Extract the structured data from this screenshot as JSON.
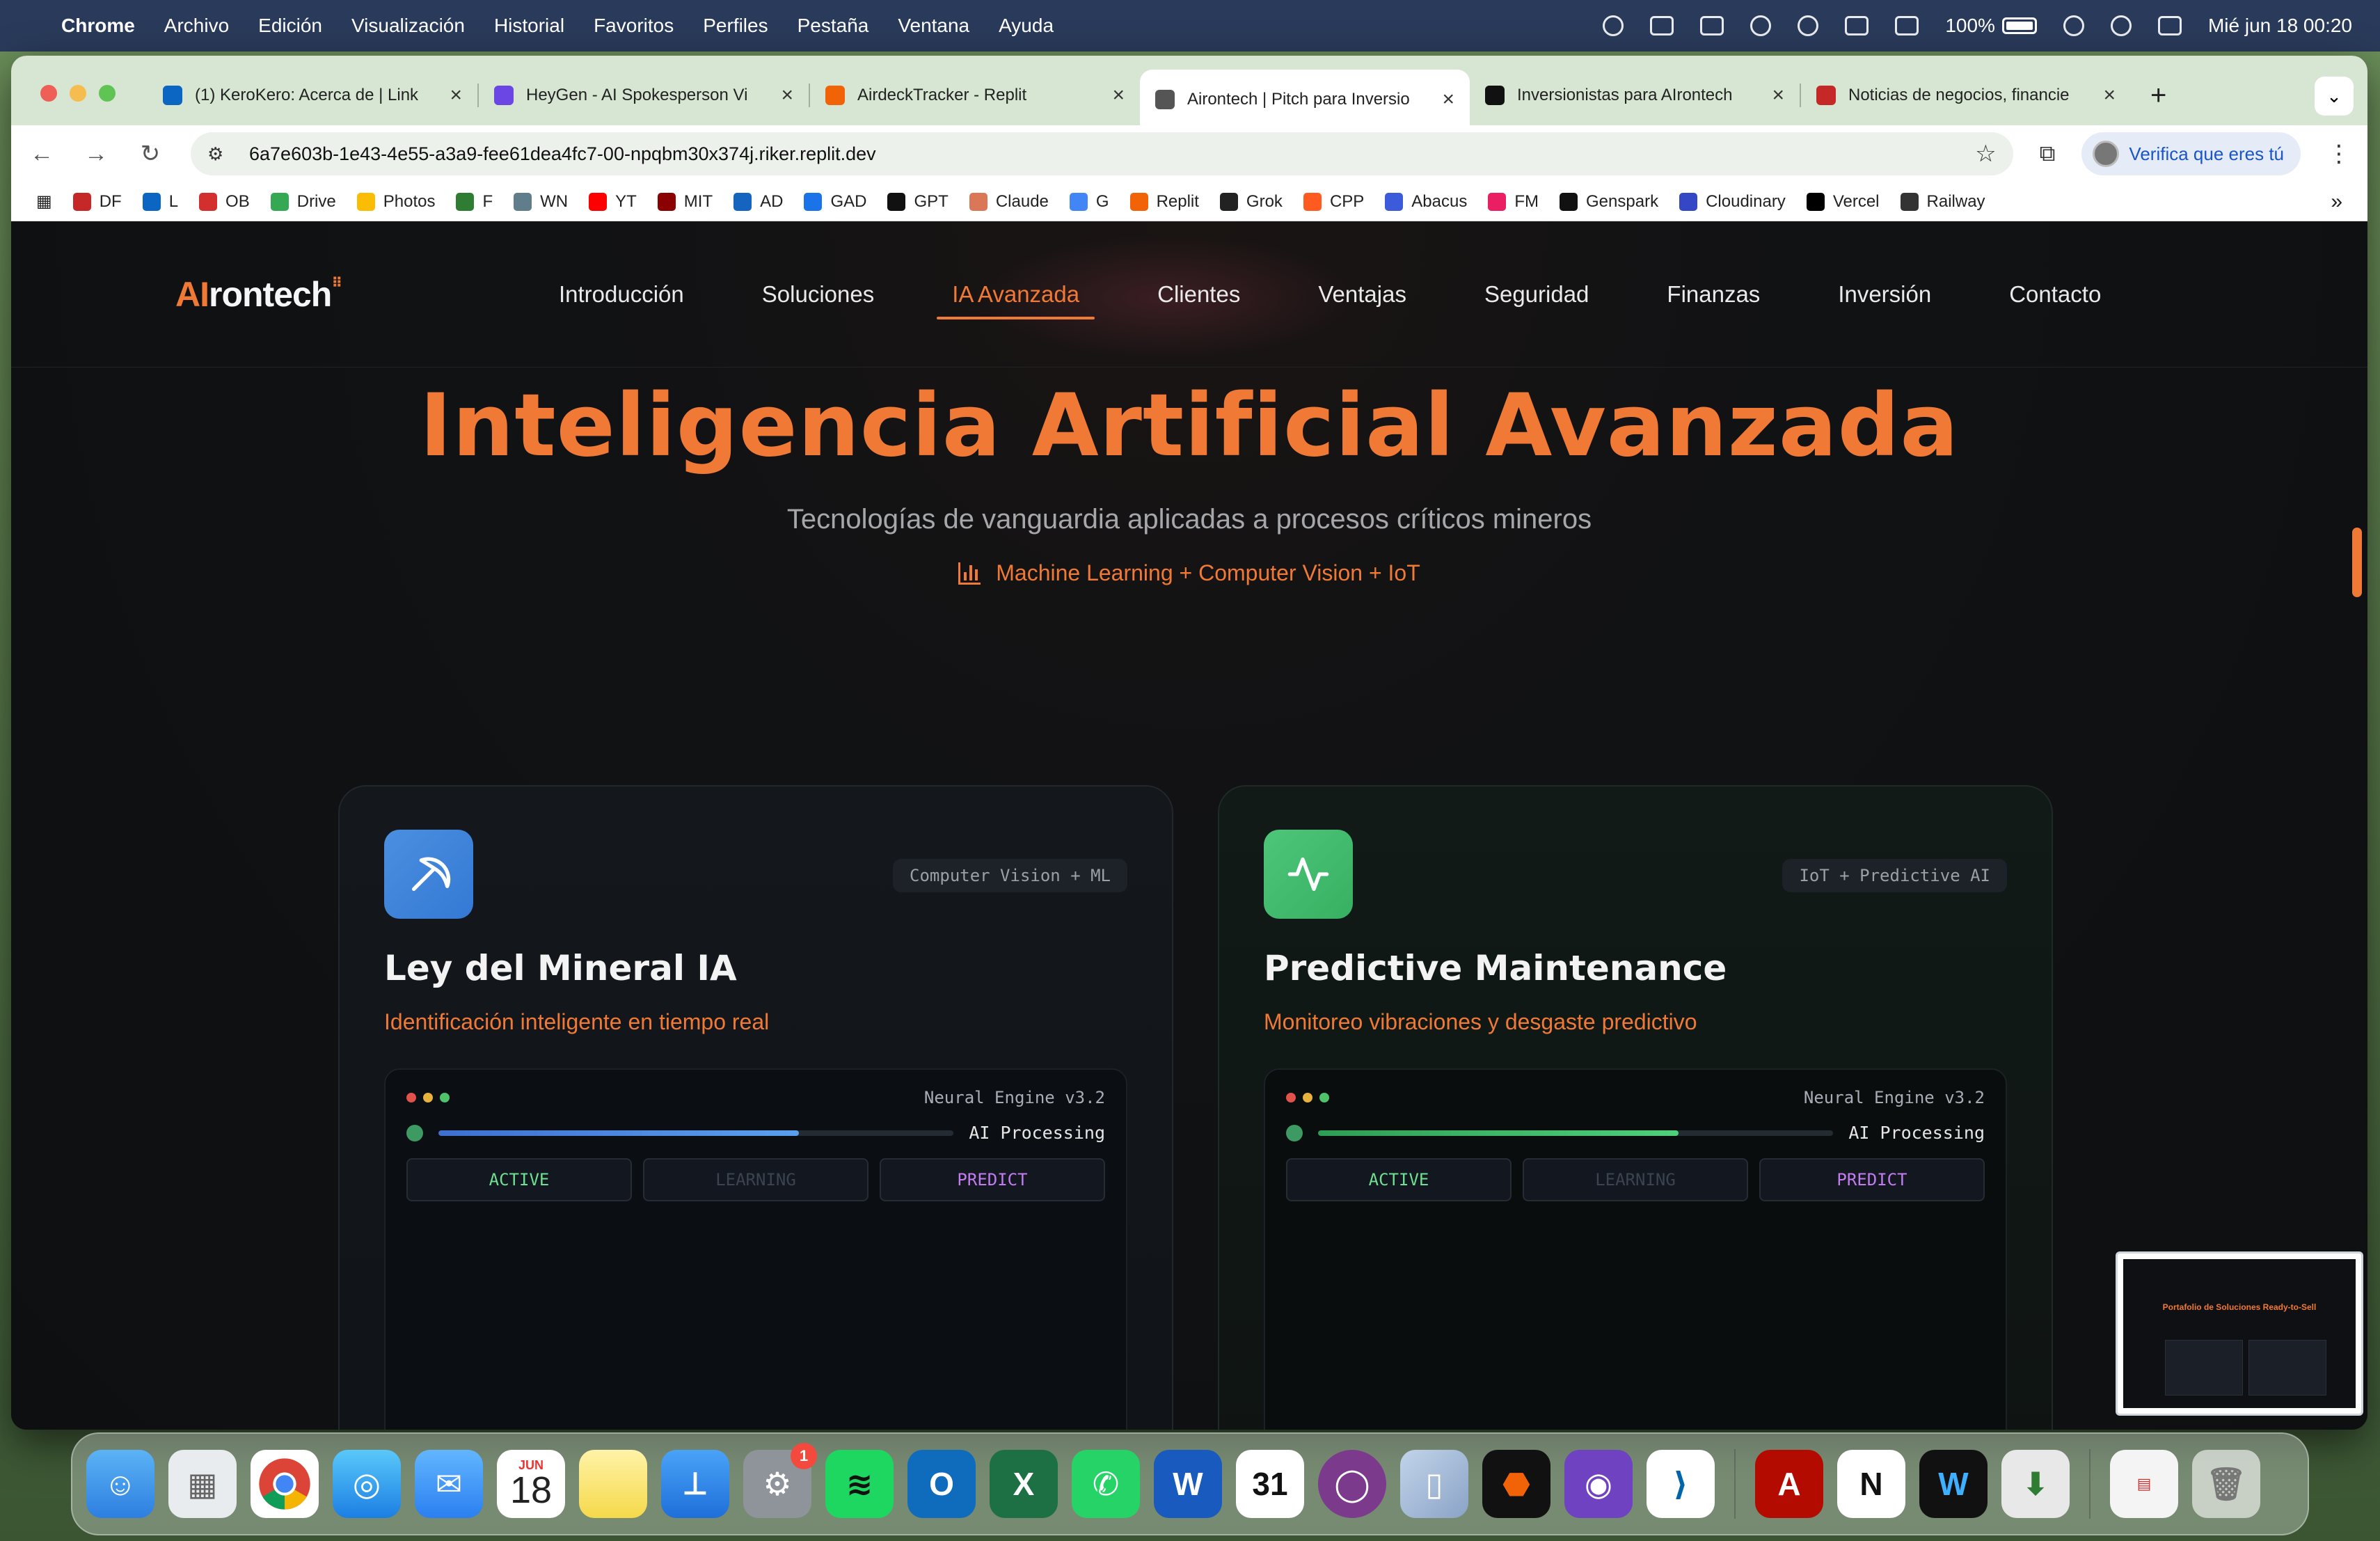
{
  "menubar": {
    "app_name": "Chrome",
    "menus": [
      "Archivo",
      "Edición",
      "Visualización",
      "Historial",
      "Favoritos",
      "Perfiles",
      "Pestaña",
      "Ventana",
      "Ayuda"
    ],
    "battery": "100%",
    "datetime": "Mié jun 18  00:20"
  },
  "browser": {
    "tabs": [
      {
        "title": "(1) KeroKero: Acerca de | Link",
        "favicon_color": "#0a66c2"
      },
      {
        "title": "HeyGen - AI Spokesperson Vi",
        "favicon_color": "#6b46e5"
      },
      {
        "title": "AirdeckTracker - Replit",
        "favicon_color": "#f26207"
      },
      {
        "title": "Airontech | Pitch para Inversio",
        "favicon_color": "#555555"
      },
      {
        "title": "Inversionistas para AIrontech",
        "favicon_color": "#111111"
      },
      {
        "title": "Noticias de negocios, financie",
        "favicon_color": "#c62828"
      }
    ],
    "url": "6a7e603b-1e43-4e55-a3a9-fee61dea4fc7-00-npqbm30x374j.riker.replit.dev",
    "verify_label": "Verifica que eres tú",
    "bookmarks": [
      {
        "label": "DF",
        "color": "#c62828"
      },
      {
        "label": "L",
        "color": "#0a66c2"
      },
      {
        "label": "OB",
        "color": "#d32f2f"
      },
      {
        "label": "Drive",
        "color": "#34a853"
      },
      {
        "label": "Photos",
        "color": "#fbbc04"
      },
      {
        "label": "F",
        "color": "#2e7d32"
      },
      {
        "label": "WN",
        "color": "#607d8b"
      },
      {
        "label": "YT",
        "color": "#ff0000"
      },
      {
        "label": "MIT",
        "color": "#8b0000"
      },
      {
        "label": "AD",
        "color": "#1565c0"
      },
      {
        "label": "GAD",
        "color": "#1a73e8"
      },
      {
        "label": "GPT",
        "color": "#111111"
      },
      {
        "label": "Claude",
        "color": "#d97757"
      },
      {
        "label": "G",
        "color": "#4285f4"
      },
      {
        "label": "Replit",
        "color": "#f26207"
      },
      {
        "label": "Grok",
        "color": "#222222"
      },
      {
        "label": "CPP",
        "color": "#ff5a1f"
      },
      {
        "label": "Abacus",
        "color": "#3b5bdb"
      },
      {
        "label": "FM",
        "color": "#e91e63"
      },
      {
        "label": "Genspark",
        "color": "#111111"
      },
      {
        "label": "Cloudinary",
        "color": "#3448c5"
      },
      {
        "label": "Vercel",
        "color": "#000000"
      },
      {
        "label": "Railway",
        "color": "#333333"
      }
    ]
  },
  "site": {
    "logo_ai": "AI",
    "logo_rest": "rontech",
    "nav": [
      "Introducción",
      "Soluciones",
      "IA Avanzada",
      "Clientes",
      "Ventajas",
      "Seguridad",
      "Finanzas",
      "Inversión",
      "Contacto"
    ],
    "active_nav": "IA Avanzada",
    "hero_title": "Inteligencia Artificial Avanzada",
    "hero_subtitle": "Tecnologías de vanguardia aplicadas a procesos críticos mineros",
    "hero_tagline": "Machine Learning + Computer Vision + IoT",
    "accent_color": "#f07a35",
    "cards": [
      {
        "badge": "Computer Vision + ML",
        "title": "Ley del Mineral IA",
        "description": "Identificación inteligente en tiempo real",
        "engine": "Neural Engine v3.2",
        "processing_label": "AI Processing",
        "progress": 0.7,
        "modes": [
          "ACTIVE",
          "LEARNING",
          "PREDICT"
        ]
      },
      {
        "badge": "IoT + Predictive AI",
        "title": "Predictive Maintenance",
        "description": "Monitoreo vibraciones y desgaste predictivo",
        "engine": "Neural Engine v3.2",
        "processing_label": "AI Processing",
        "progress": 0.7,
        "modes": [
          "ACTIVE",
          "LEARNING",
          "PREDICT"
        ]
      }
    ]
  },
  "preview": {
    "title": "Portafolio de Soluciones Ready-to-Sell"
  },
  "dock": {
    "calendar_month": "JUN",
    "calendar_day": "18",
    "settings_badge": "1",
    "apps": [
      "finder-icon",
      "launchpad-icon",
      "chrome-icon",
      "safari-icon",
      "mail-icon",
      "calendar-icon",
      "notes-icon",
      "keynote-icon",
      "system-settings-icon",
      "spotify-icon",
      "outlook-icon",
      "excel-icon",
      "whatsapp-icon",
      "word-icon",
      "fantastical-icon",
      "circle-app-icon",
      "iphone-mirroring-icon",
      "replit-icon",
      "github-icon",
      "vscode-icon",
      "acrobat-icon",
      "notion-icon",
      "webex-icon",
      "installer-icon",
      "document-icon",
      "trash-icon"
    ]
  }
}
